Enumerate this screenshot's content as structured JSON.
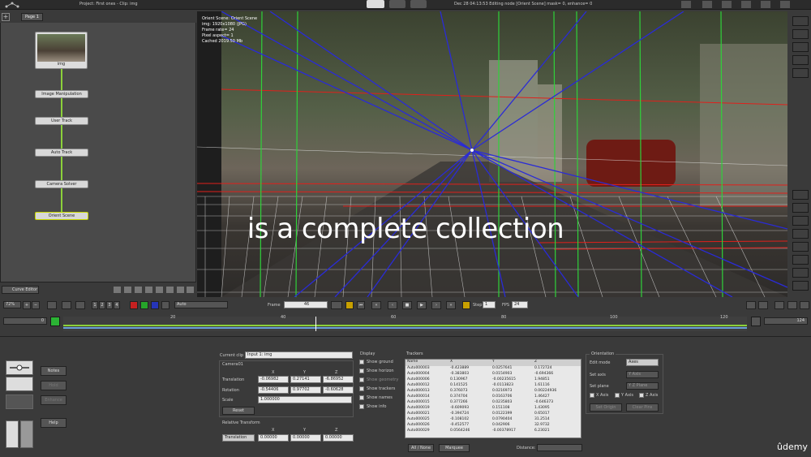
{
  "topbar": {
    "project": "Project: First ones - Clip: img",
    "status": "Dec 28 04:13:53 Editing node [Orient Scene] mask= 0, enhance= 0"
  },
  "nodes": {
    "tab": "Page 1",
    "items": [
      "img",
      "Image Manipulation",
      "User Track",
      "Auto Track",
      "Camera Solver",
      "Orient Scene"
    ]
  },
  "node_toolbar": {
    "curve_editor": "Curve Editor"
  },
  "viewer": {
    "info": [
      "Orient Scene: Orient Scene",
      "img: 1920x1080 (JPG)",
      "Frame rate= 24",
      "Pixel aspect= 1",
      "Cached 2019.50 Mb"
    ]
  },
  "caption": "is a complete collection",
  "watermark": "ûdemy",
  "playbar": {
    "zoom": "72%",
    "channels": [
      "1",
      "2",
      "3",
      "4"
    ],
    "mode": "Auto",
    "frame_label": "Frame",
    "frame": "46",
    "step_label": "Step",
    "step": "1",
    "fps_label": "FPS",
    "fps": "24"
  },
  "timeline": {
    "start": "0",
    "end": "124",
    "ticks": [
      "20",
      "40",
      "60",
      "80",
      "100",
      "120"
    ]
  },
  "left_buttons": {
    "notes": "Notes",
    "hold": "Hold",
    "enhance": "Enhance",
    "help": "Help"
  },
  "clip": {
    "label": "Current clip",
    "value": "Input 1: img",
    "camera": "Camera01",
    "cols": [
      "X",
      "Y",
      "Z"
    ],
    "translation_label": "Translation",
    "translation": [
      "-0.06982",
      "0.27141",
      "-6.86952"
    ],
    "rotation_label": "Rotation",
    "rotation": [
      "-0.54406",
      "0.97702",
      "-0.60628"
    ],
    "scale_label": "Scale",
    "scale": "1.000000",
    "reset": "Reset",
    "relative_label": "Relative Transform",
    "rel_mode": "Translation",
    "rel": [
      "0.00000",
      "0.00000",
      "0.00000"
    ]
  },
  "display": {
    "title": "Display",
    "options": [
      "Show ground",
      "Show horizon",
      "Show geometry",
      "Show trackers",
      "Show names",
      "Show info"
    ]
  },
  "trackers": {
    "title": "Trackers",
    "cols": [
      "Name",
      "X",
      "Y",
      "Z"
    ],
    "rows": [
      [
        "Auto000003",
        "-0.423889",
        "0.0257641",
        "0.172724"
      ],
      [
        "Auto000004",
        "-0.383803",
        "0.0154903",
        "-0.694366"
      ],
      [
        "Auto000006",
        "0.130967",
        "-0.00235615",
        "1.94851"
      ],
      [
        "Auto000012",
        "0.141525",
        "-0.0113823",
        "1.61116"
      ],
      [
        "Auto000013",
        "0.376073",
        "0.0216973",
        "0.00224936"
      ],
      [
        "Auto000014",
        "0.374704",
        "0.0163706",
        "1.46427"
      ],
      [
        "Auto000015",
        "0.377266",
        "0.0235803",
        "-0.646373"
      ],
      [
        "Auto000019",
        "-0.609093",
        "0.151108",
        "1.43095"
      ],
      [
        "Auto000021",
        "-0.394724",
        "0.0122399",
        "0.65017"
      ],
      [
        "Auto000025",
        "-0.108102",
        "0.0790404",
        "31.2514"
      ],
      [
        "Auto000026",
        "-0.452577",
        "0.042906",
        "32.9732"
      ],
      [
        "Auto000029",
        "0.0564246",
        "-0.00378917",
        "6.23021"
      ]
    ],
    "all_none": "All / None",
    "marquee": "Marquee",
    "distance_label": "Distance:"
  },
  "orientation": {
    "title": "Orientation",
    "edit_mode_label": "Edit mode",
    "edit_mode": "Axes",
    "set_axis_label": "Set axis",
    "set_axis": "Y Axis",
    "set_plane_label": "Set plane",
    "set_plane": "Y Z Plane",
    "axes": [
      "X Axis",
      "Y Axis",
      "Z Axis"
    ],
    "set_origin": "Set Origin",
    "clear_pins": "Clear Pins"
  }
}
